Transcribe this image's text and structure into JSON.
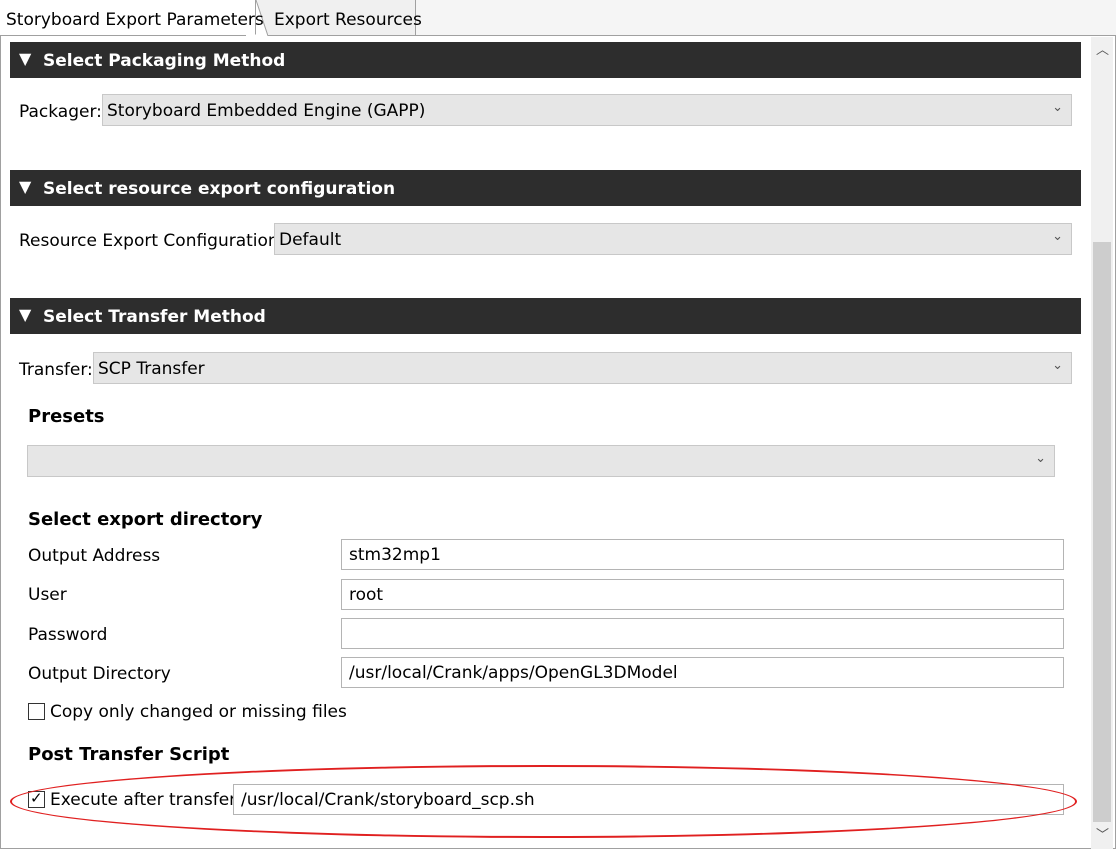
{
  "tabs": [
    {
      "label": "Storyboard Export Parameters"
    },
    {
      "label": "Export Resources"
    }
  ],
  "sections": {
    "packaging": {
      "title": "Select Packaging Method",
      "label": "Packager:",
      "value": "Storyboard Embedded Engine (GAPP)"
    },
    "resource": {
      "title": "Select resource export configuration",
      "label": "Resource Export Configuration:",
      "value": "Default"
    },
    "transfer": {
      "title": "Select Transfer Method",
      "label": "Transfer:",
      "value": "SCP Transfer"
    }
  },
  "presets": {
    "heading": "Presets",
    "value": ""
  },
  "export_dir": {
    "heading": "Select export directory",
    "output_address": {
      "label": "Output Address",
      "value": "stm32mp1"
    },
    "user": {
      "label": "User",
      "value": "root"
    },
    "password": {
      "label": "Password",
      "value": ""
    },
    "output_directory": {
      "label": "Output Directory",
      "value": "/usr/local/Crank/apps/OpenGL3DModel"
    },
    "copy_changed": {
      "label": "Copy only changed or missing files",
      "checked": false
    }
  },
  "post_script": {
    "heading": "Post Transfer Script",
    "execute": {
      "label": "Execute after transfer",
      "checked": true
    },
    "path": "/usr/local/Crank/storyboard_scp.sh"
  },
  "icons": {
    "collapse": "triangle-down-icon",
    "dropdown": "chevron-down-icon",
    "check": "checkmark-icon"
  },
  "colors": {
    "section_header": "#2d2d2d",
    "highlight_oval": "#e02020"
  }
}
